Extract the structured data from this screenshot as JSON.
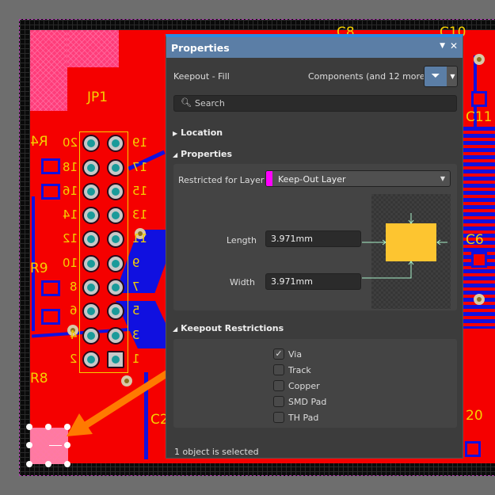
{
  "pcb": {
    "designators": {
      "jp1": "JP1",
      "r4": "R4",
      "r9": "R9",
      "r8": "R8",
      "c2": "C2",
      "c8": "C8",
      "c10": "C10",
      "c11": "C11",
      "c6": "C6",
      "pin20_right": "20"
    },
    "pins_left": [
      "20",
      "18",
      "16",
      "14",
      "12",
      "10",
      "8",
      "6",
      "4",
      "2"
    ],
    "pins_right": [
      "19",
      "17",
      "15",
      "13",
      "11",
      "9",
      "7",
      "5",
      "3",
      "1"
    ],
    "colors": {
      "top_copper": "#f50000",
      "bottom_copper": "#1010e0",
      "silkscreen": "#f5d000",
      "keepout": "#ff3d7a",
      "arrow": "#ff7a00"
    }
  },
  "panel": {
    "title": "Properties",
    "object_type": "Keepout - Fill",
    "filter_text": "Components (and 12 more)",
    "search_placeholder": "Search",
    "sections": {
      "location": "Location",
      "properties": "Properties",
      "keepout": "Keepout Restrictions"
    },
    "restricted_label": "Restricted for Layer",
    "restricted_value": "Keep-Out Layer",
    "layer_color": "#ff00ff",
    "length_label": "Length",
    "length_value": "3.971mm",
    "width_label": "Width",
    "width_value": "3.971mm",
    "restrictions": [
      {
        "label": "Via",
        "checked": true
      },
      {
        "label": "Track",
        "checked": false
      },
      {
        "label": "Copper",
        "checked": false
      },
      {
        "label": "SMD Pad",
        "checked": false
      },
      {
        "label": "TH Pad",
        "checked": false
      }
    ],
    "status": "1 object is selected"
  }
}
